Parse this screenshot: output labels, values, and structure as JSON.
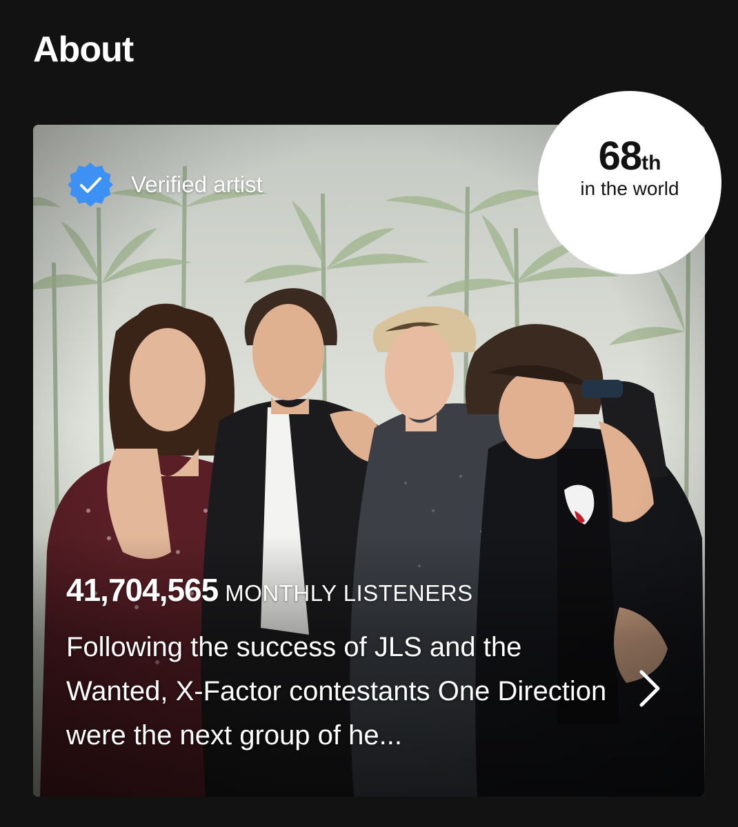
{
  "section": {
    "title": "About"
  },
  "card": {
    "verified": {
      "label": "Verified artist",
      "icon": "verified-badge-icon",
      "color": "#3D91F4"
    },
    "rank": {
      "number": "68",
      "suffix": "th",
      "caption": "in the world"
    },
    "listeners": {
      "count": "41,704,565",
      "label": "MONTHLY LISTENERS"
    },
    "bio": "Following the success of JLS and the Wanted, X-Factor contestants One Direction were the next group of he...",
    "chevron_icon": "chevron-right-icon"
  },
  "colors": {
    "background": "#121212",
    "text": "#FFFFFF",
    "badge_background": "#FFFFFF",
    "badge_text": "#121212"
  }
}
